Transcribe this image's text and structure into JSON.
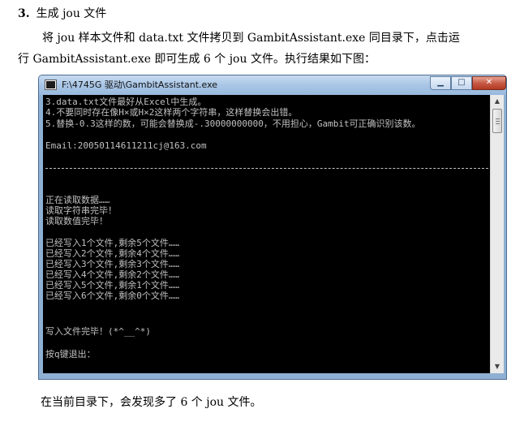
{
  "section": {
    "number": "3.",
    "title": "生成 jou 文件"
  },
  "paragraphs": {
    "p1": "将 jou 样本文件和 data.txt 文件拷贝到 GambitAssistant.exe 同目录下，点击运",
    "p2": "行 GambitAssistant.exe 即可生成 6 个 jou 文件。执行结果如下图：",
    "p3": "在当前目录下，会发现多了 6 个 jou 文件。"
  },
  "window": {
    "title": "F:\\4745G 驱动\\GambitAssistant.exe",
    "minimize_glyph": "▁",
    "maximize_glyph": "□",
    "close_glyph": "✕"
  },
  "console": {
    "lines": [
      "3.data.txt文件最好从Excel中生成。",
      "4.不要同时存在像H×或H×2这样两个字符串，这样替换会出错。",
      "5.替换-0.3这样的数，可能会替换成-.30000000000，不用担心，Gambit可正确识别该数。",
      "Email:20050114611211cj@163.com",
      "正在读取数据……",
      "读取字符串完毕！",
      "读取数值完毕！",
      "已经写入1个文件,剩余5个文件……",
      "已经写入2个文件,剩余4个文件……",
      "已经写入3个文件,剩余3个文件……",
      "已经写入4个文件,剩余2个文件……",
      "已经写入5个文件,剩余1个文件……",
      "已经写入6个文件,剩余0个文件……",
      "写入文件完毕！(*^__^*)",
      "按q键退出："
    ]
  },
  "scrollbar": {
    "up_glyph": "▲",
    "down_glyph": "▼"
  },
  "colors": {
    "console_bg": "#000000",
    "console_text": "#c0c0c0",
    "close_button": "#c75a45"
  }
}
